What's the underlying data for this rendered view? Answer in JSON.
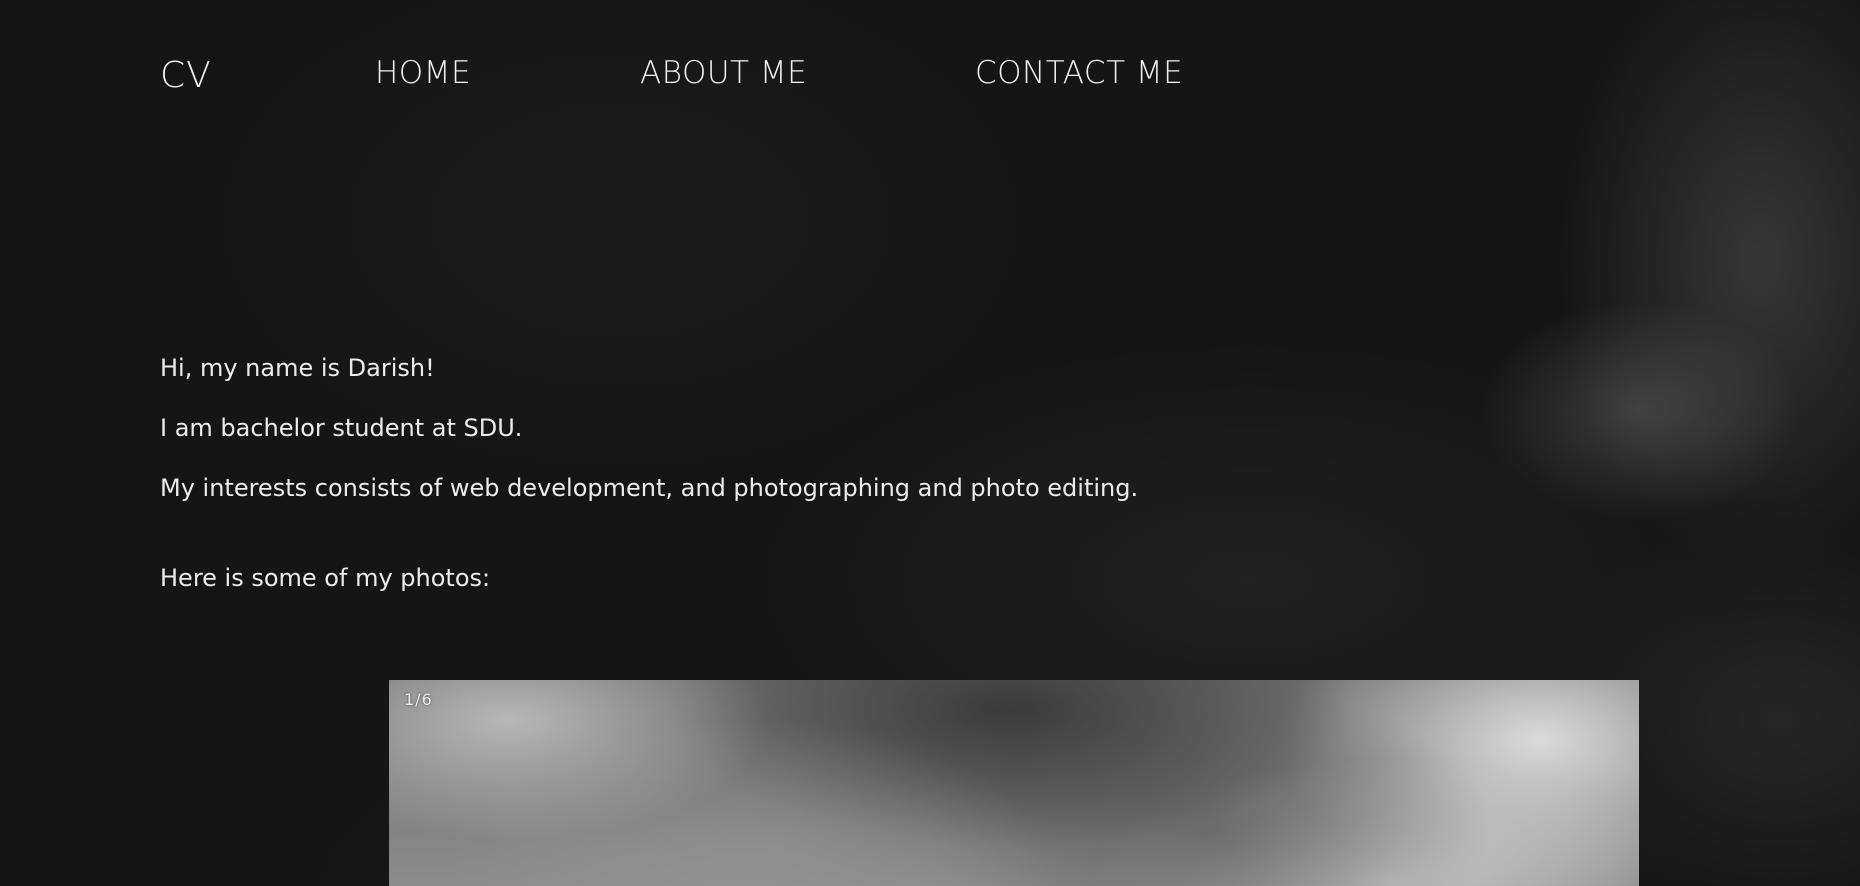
{
  "header": {
    "logo": "CV",
    "nav": [
      {
        "label": "HOME"
      },
      {
        "label": "ABOUT ME"
      },
      {
        "label": "CONTACT ME"
      }
    ]
  },
  "intro": {
    "greeting": "Hi, my name is Darish!",
    "study": "I am bachelor student at SDU.",
    "interests": "My interests consists of web development, and photographing and photo editing.",
    "photos_heading": "Here is some of my photos:"
  },
  "slideshow": {
    "counter": "1/6",
    "current": 1,
    "total": 6
  }
}
